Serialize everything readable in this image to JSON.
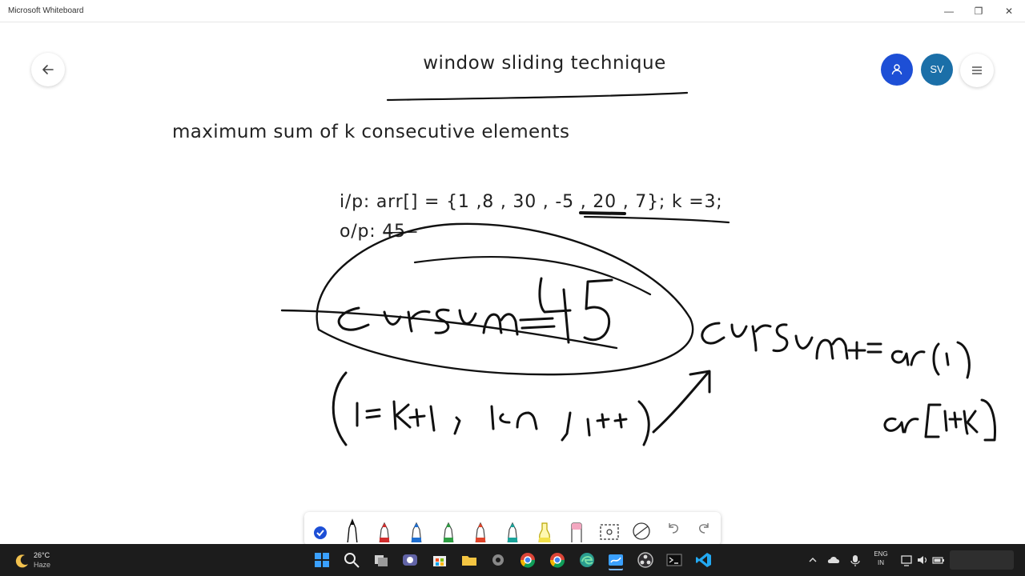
{
  "window": {
    "title": "Microsoft Whiteboard",
    "controls": [
      "—",
      "❐",
      "✕"
    ]
  },
  "board": {
    "title": "window sliding technique",
    "heading": "maximum sum of k consecutive elements",
    "input_line": "i/p: arr[] = {1 ,8 , 30 , -5 , 20 , 7}; k =3;",
    "output_line": "o/p: 45"
  },
  "avatars": [
    {
      "label": "",
      "color": "#1d4fd6",
      "icon": "person-icon"
    },
    {
      "label": "SV",
      "color": "#1b6fa8"
    }
  ],
  "toolbar": {
    "tools": [
      "touch-draw-icon",
      "black-pen-icon",
      "red-pen-icon",
      "blue-pen-icon",
      "green-pen-icon",
      "red-pen-icon",
      "teal-pen-icon",
      "highlighter-icon",
      "eraser-icon",
      "lasso-icon",
      "ruler-icon",
      "undo-icon",
      "redo-icon"
    ]
  },
  "taskbar": {
    "weather_temp": "26°C",
    "weather_condition": "Haze",
    "language": "ENG",
    "region": "IN",
    "icons": [
      "start-icon",
      "search-icon",
      "task-view-icon",
      "teams-icon",
      "store-icon",
      "explorer-icon",
      "settings-icon",
      "chrome-icon",
      "chrome-icon",
      "edge-icon",
      "whiteboard-icon",
      "obs-icon",
      "terminal-icon",
      "vscode-icon"
    ]
  },
  "colors": {
    "accent_blue": "#1d4fd6",
    "avatar_sv": "#1b6fa8",
    "ink": "#111111"
  }
}
